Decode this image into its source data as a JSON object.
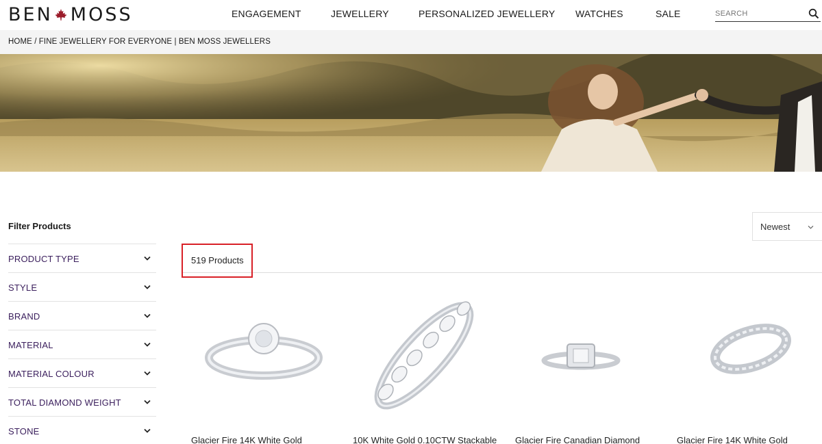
{
  "header": {
    "logo_left": "BEN",
    "logo_right": "MOSS",
    "nav": [
      "ENGAGEMENT",
      "JEWELLERY",
      "PERSONALIZED JEWELLERY",
      "WATCHES",
      "SALE"
    ],
    "search_placeholder": "SEARCH"
  },
  "breadcrumb": "HOME / FINE JEWELLERY FOR EVERYONE | BEN MOSS JEWELLERS",
  "sidebar": {
    "title": "Filter Products",
    "filters": [
      "PRODUCT TYPE",
      "STYLE",
      "BRAND",
      "MATERIAL",
      "MATERIAL COLOUR",
      "TOTAL DIAMOND WEIGHT",
      "STONE"
    ]
  },
  "sort": {
    "selected": "Newest"
  },
  "results": {
    "count_label": "519 Products"
  },
  "products": [
    {
      "name": "Glacier Fire 14K White Gold"
    },
    {
      "name": "10K White Gold 0.10CTW Stackable"
    },
    {
      "name": "Glacier Fire Canadian Diamond"
    },
    {
      "name": "Glacier Fire 14K White Gold"
    }
  ],
  "colors": {
    "filter_label": "#3a1e5c",
    "highlight_box": "#d81f26",
    "leaf": "#9b1b2a"
  }
}
